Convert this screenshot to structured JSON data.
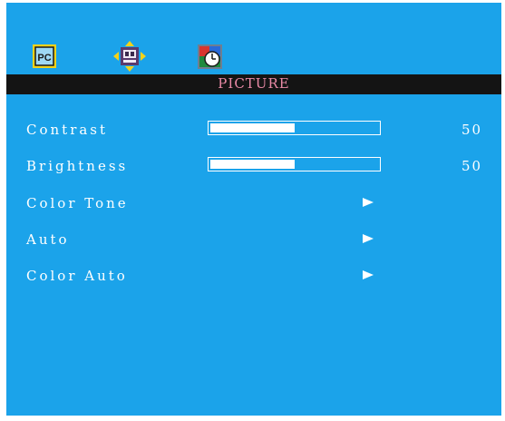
{
  "menu": {
    "title": "PICTURE",
    "tabs": [
      {
        "icon": "pc-icon",
        "selected": true
      },
      {
        "icon": "position-icon",
        "selected": false
      },
      {
        "icon": "clock-icon",
        "selected": false
      }
    ],
    "items": [
      {
        "label": "Contrast",
        "type": "slider",
        "value": "50",
        "level_fraction": 0.5
      },
      {
        "label": "Brightness",
        "type": "slider",
        "value": "50",
        "level_fraction": 0.5
      },
      {
        "label": "Color Tone",
        "type": "submenu"
      },
      {
        "label": "Auto",
        "type": "submenu"
      },
      {
        "label": "Color Auto",
        "type": "submenu"
      }
    ]
  },
  "colors": {
    "background": "#1ba3ea",
    "title_bar": "#141414",
    "title_text": "#e98aa6",
    "text": "#ffffff"
  }
}
